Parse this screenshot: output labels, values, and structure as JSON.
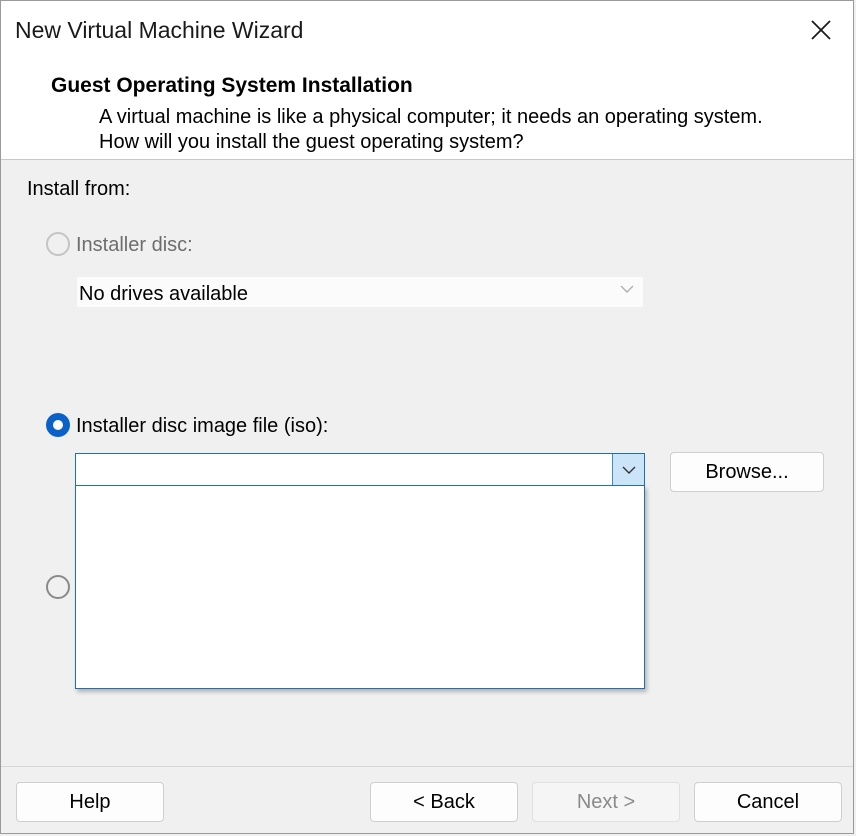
{
  "window": {
    "title": "New Virtual Machine Wizard",
    "close_icon": "close-icon"
  },
  "header": {
    "title": "Guest Operating System Installation",
    "description": "A virtual machine is like a physical computer; it needs an operating system. How will you install the guest operating system?"
  },
  "install_from": {
    "label": "Install from:",
    "options": [
      {
        "label": "Installer disc:",
        "selected": false,
        "enabled": false
      },
      {
        "label": "Installer disc image file (iso):",
        "selected": true,
        "enabled": true
      },
      {
        "label": "",
        "selected": false,
        "enabled": true
      }
    ],
    "disc_combo": {
      "value": "No drives available",
      "enabled": false
    },
    "iso_combo": {
      "value": "",
      "expanded": true,
      "items": []
    },
    "browse_label": "Browse..."
  },
  "footer": {
    "help_label": "Help",
    "back_label": "< Back",
    "next_label": "Next >",
    "next_enabled": false,
    "cancel_label": "Cancel"
  },
  "colors": {
    "accent": "#0a62c9",
    "focus_border": "#1f6fb4",
    "dropdown_button_bg": "#cce4f7"
  }
}
